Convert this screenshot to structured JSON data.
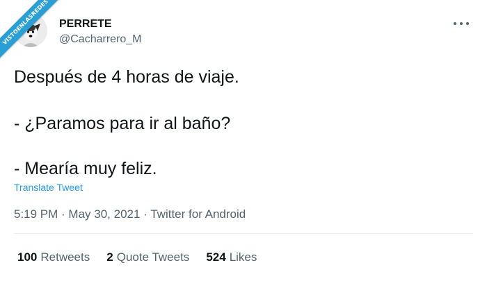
{
  "watermark": {
    "text": "VISTOENLASREDES"
  },
  "author": {
    "display_name": "PERRETE",
    "handle": "@Cacharrero_M"
  },
  "tweet": {
    "lines": [
      "Después de 4 horas de viaje.",
      "- ¿Paramos para ir al baño?",
      "- Mearía muy feliz."
    ],
    "translate_label": "Translate Tweet",
    "timestamp": "5:19 PM · May 30, 2021 · Twitter for Android"
  },
  "stats": {
    "retweets_count": "100",
    "retweets_label": "Retweets",
    "quotes_count": "2",
    "quotes_label": "Quote Tweets",
    "likes_count": "524",
    "likes_label": "Likes"
  },
  "icons": {
    "more": "more-horizontal-icon",
    "avatar": "dog-avatar"
  },
  "colors": {
    "text_primary": "#0f1419",
    "text_secondary": "#536471",
    "link": "#1d9bf0",
    "ribbon": "#2a9fd6",
    "divider": "#e6ecf0"
  }
}
